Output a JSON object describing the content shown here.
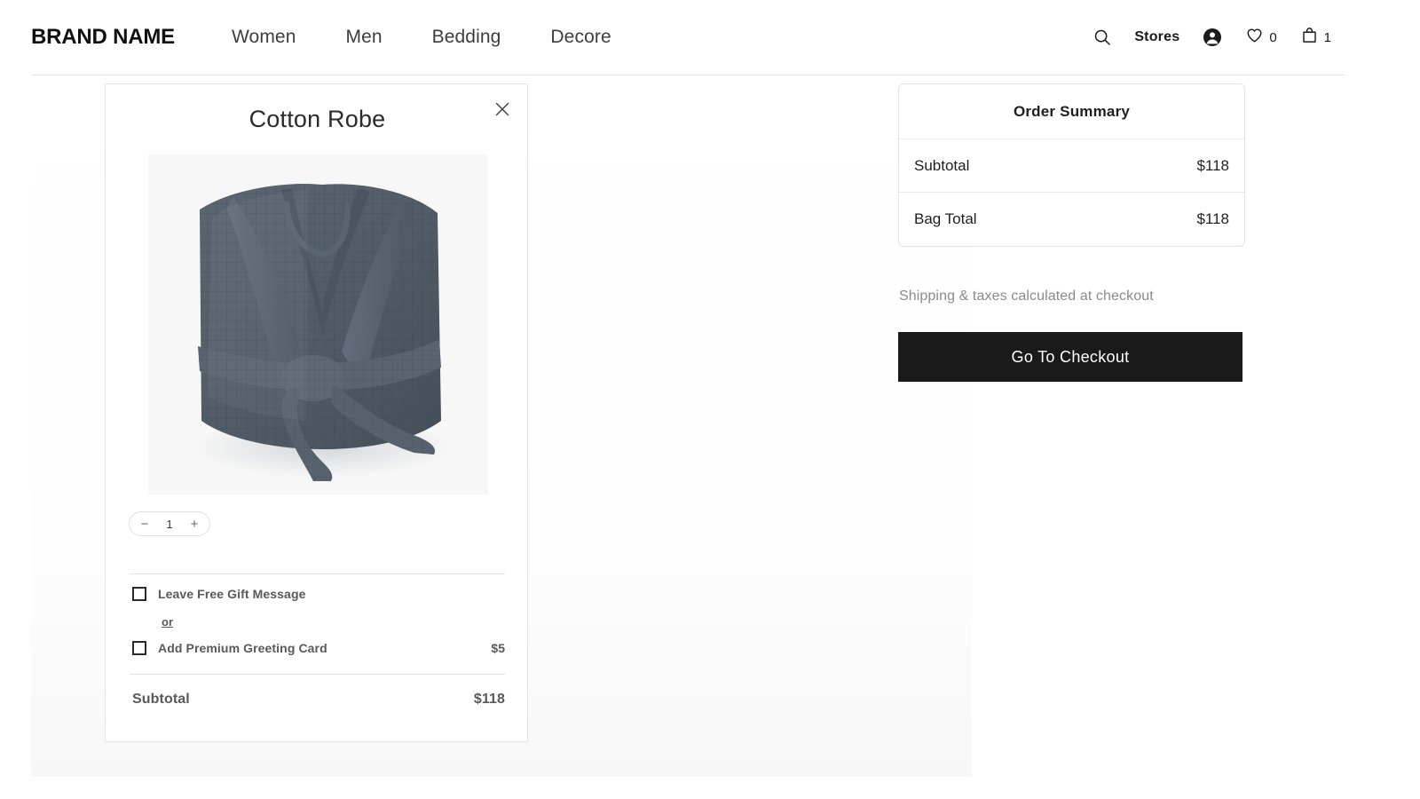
{
  "header": {
    "brand": "BRAND NAME",
    "nav": [
      {
        "label": "Women"
      },
      {
        "label": "Men"
      },
      {
        "label": "Bedding"
      },
      {
        "label": "Decore"
      }
    ],
    "search_icon": "search-icon",
    "stores_label": "Stores",
    "account_icon": "account-icon",
    "wishlist_icon": "heart-icon",
    "wishlist_count": "0",
    "bag_icon": "shopping-bag-icon",
    "bag_count": "1"
  },
  "product_card": {
    "title": "Cotton Robe",
    "close_icon": "close-icon",
    "image_alt": "Folded dark gray waffle cotton robe",
    "quantity": {
      "decrement_label": "−",
      "value": "1",
      "increment_label": "+"
    },
    "gift_options": [
      {
        "label": "Leave Free Gift Message",
        "price": "",
        "checked": false
      },
      {
        "label": "Add Premium Greeting Card",
        "price": "$5",
        "checked": false
      }
    ],
    "or_label": "or",
    "subtotal_label": "Subtotal",
    "subtotal_value": "$118"
  },
  "order_summary": {
    "title": "Order Summary",
    "rows": [
      {
        "label": "Subtotal",
        "value": "$118"
      },
      {
        "label": "Bag Total",
        "value": "$118"
      }
    ],
    "shipping_note": "Shipping & taxes calculated at checkout",
    "checkout_label": "Go To Checkout"
  },
  "colors": {
    "accent": "#1a1a1a",
    "text": "#1f1f1f",
    "muted": "#8a8a8a",
    "label_gray": "#58595b",
    "border": "#e4e4e4",
    "robe": "#555f69"
  }
}
